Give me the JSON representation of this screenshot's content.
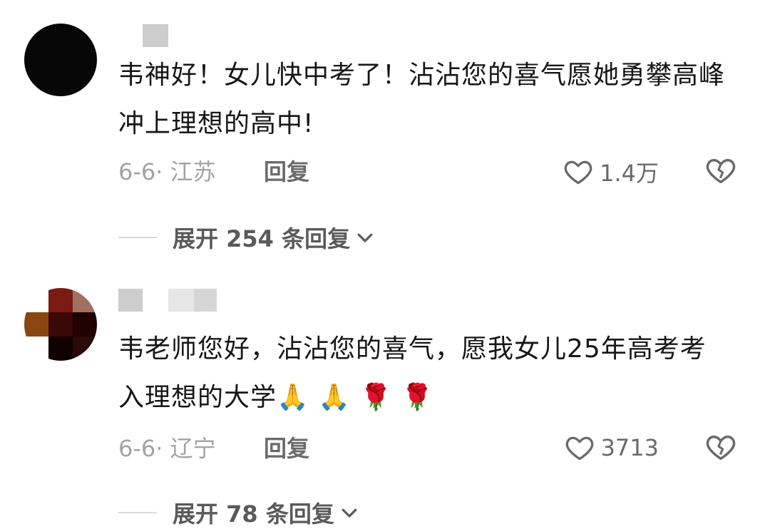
{
  "comments": [
    {
      "text": "韦神好！女儿快中考了！沾沾您的喜气愿她勇攀高峰 冲上理想的高中!",
      "meta": "6-6· 江苏",
      "reply_label": "回复",
      "likes": "1.4万",
      "expand_label": "展开 254 条回复"
    },
    {
      "text": "韦老师您好，沾沾您的喜气，愿我女儿25年高考考入理想的大学",
      "emojis": "🙏 🙏 🌹 🌹",
      "meta": "6-6· 辽宁",
      "reply_label": "回复",
      "likes": "3713",
      "expand_label": "展开 78 条回复"
    }
  ],
  "icons": {
    "like": "heart-outline-icon",
    "dislike": "broken-heart-icon",
    "expand": "chevron-down-icon"
  },
  "colors": {
    "text": "#161616",
    "meta": "#a3a3a3",
    "action": "#6a6a6a"
  }
}
